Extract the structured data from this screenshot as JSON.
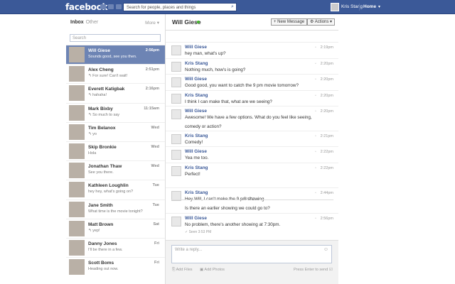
{
  "topbar": {
    "logo": "facebook",
    "search_placeholder": "Search for people, places and things",
    "search_icon": "search-icon",
    "user_name": "Kris Stang",
    "home_label": "Home",
    "caret": "▾"
  },
  "left": {
    "inbox_label": "Inbox",
    "other_label": "Other",
    "more_label": "More ▾",
    "search_placeholder": "Search",
    "threads": [
      {
        "name": "Will Giese",
        "snippet": "Sounds good, see you then.",
        "time": "2:56pm",
        "selected": true
      },
      {
        "name": "Alex Cheng",
        "snippet": "↰ For sure! Can't wait!",
        "time": "2:51pm"
      },
      {
        "name": "Everett Katigbak",
        "snippet": "↰ hahaha!",
        "time": "2:16pm"
      },
      {
        "name": "Mark Bixby",
        "snippet": "↰ So much to say",
        "time": "11:15am"
      },
      {
        "name": "Tim Belanox",
        "snippet": "↰ yo",
        "time": "Wed"
      },
      {
        "name": "Skip Bronkie",
        "snippet": "Hola",
        "time": "Wed"
      },
      {
        "name": "Jonathan Thaw",
        "snippet": "See you there.",
        "time": "Wed"
      },
      {
        "name": "Kathleen Loughlin",
        "snippet": "hey hey, what's going on?",
        "time": "Tue"
      },
      {
        "name": "Jane Smith",
        "snippet": "What time is the movie tonight?",
        "time": "Tue"
      },
      {
        "name": "Matt Brown",
        "snippet": "↰ yep!",
        "time": "Sat"
      },
      {
        "name": "Danny Jones",
        "snippet": "I'll be there in a few.",
        "time": "Fri"
      },
      {
        "name": "Scott Boms",
        "snippet": "Heading out now.",
        "time": "Fri"
      }
    ]
  },
  "conversation": {
    "title": "Will Giese",
    "new_message_label": "+ New Message",
    "actions_label": "⚙ Actions ▾",
    "messages": [
      {
        "author": "Will Giese",
        "lines": [
          "hey man, what's up?"
        ],
        "time": "2:19pm"
      },
      {
        "author": "Kris Stang",
        "lines": [
          "Nothing much, how's is going?"
        ],
        "time": "2:20pm"
      },
      {
        "author": "Will Giese",
        "lines": [
          "Good good, you want to catch the 9 pm movie tomorrow?"
        ],
        "time": "2:20pm"
      },
      {
        "author": "Kris Stang",
        "lines": [
          "I think I can make that, what are we seeing?"
        ],
        "time": "2:20pm"
      },
      {
        "author": "Will Giese",
        "lines": [
          "Awesome! We have a few options. What do you feel like seeing,",
          "comedy or action?"
        ],
        "time": "2:20pm"
      },
      {
        "author": "Kris Stang",
        "lines": [
          "Comedy!"
        ],
        "time": "2:21pm"
      },
      {
        "author": "Will Giese",
        "lines": [
          "Yea me too."
        ],
        "time": "2:22pm"
      },
      {
        "author": "Kris Stang",
        "lines": [
          "Perfect!"
        ],
        "time": "2:22pm"
      },
      {
        "author": "Kris Stang",
        "lines": [
          "Hey Will, I can't make the 9 pm showing.",
          "Is there an earlier showing we could go to?"
        ],
        "time": "2:44pm"
      },
      {
        "author": "Will Giese",
        "lines": [
          "No problem, there's another showing at 7:30pm."
        ],
        "time": "2:56pm"
      }
    ],
    "today_label": "Today",
    "seen_label": "✓ Seen 3:53 PM",
    "reply_placeholder": "Write a reply...",
    "add_files": "Add Files",
    "add_photos": "Add Photos",
    "press_enter": "Press Enter to send"
  }
}
